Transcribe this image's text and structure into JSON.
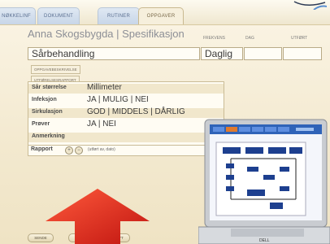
{
  "tabs": [
    {
      "label": "NØKKELINF"
    },
    {
      "label": "DOKUMENT"
    },
    {
      "label": "RUTINER"
    },
    {
      "label": "OPPGAVER"
    }
  ],
  "page_title": "Anna Skogsbygda | Spesifikasjon",
  "field_labels": [
    "FREKVENS",
    "DAG",
    "UTFØRT"
  ],
  "task": {
    "name": "Sårbehandling",
    "frequency": "Daglig"
  },
  "chips": [
    "OPPGAVEBESKRIVELSE",
    "UTFØRELSESRAPPORT"
  ],
  "rows": [
    {
      "label": "Sår størrelse",
      "value": "Millimeter"
    },
    {
      "label": "Infeksjon",
      "value": "JA | MULIG | NEI"
    },
    {
      "label": "Sirkulasjon",
      "value": "GOD | MIDDELS | DÅRLIG"
    },
    {
      "label": "Prøver",
      "value": "JA | NEI"
    },
    {
      "label": "Anmerkning",
      "value": ""
    }
  ],
  "rapport": {
    "label": "Rapport",
    "note": "(utført av, dato)"
  },
  "buttons": [
    "SENDE",
    "UTFØRT",
    "AVBRYT"
  ],
  "colors": {
    "arrow": "#e8231b",
    "tab_blue": "#c8d6e8",
    "background": "#f3e9cf"
  },
  "laptop": {
    "brand": "DELL"
  }
}
